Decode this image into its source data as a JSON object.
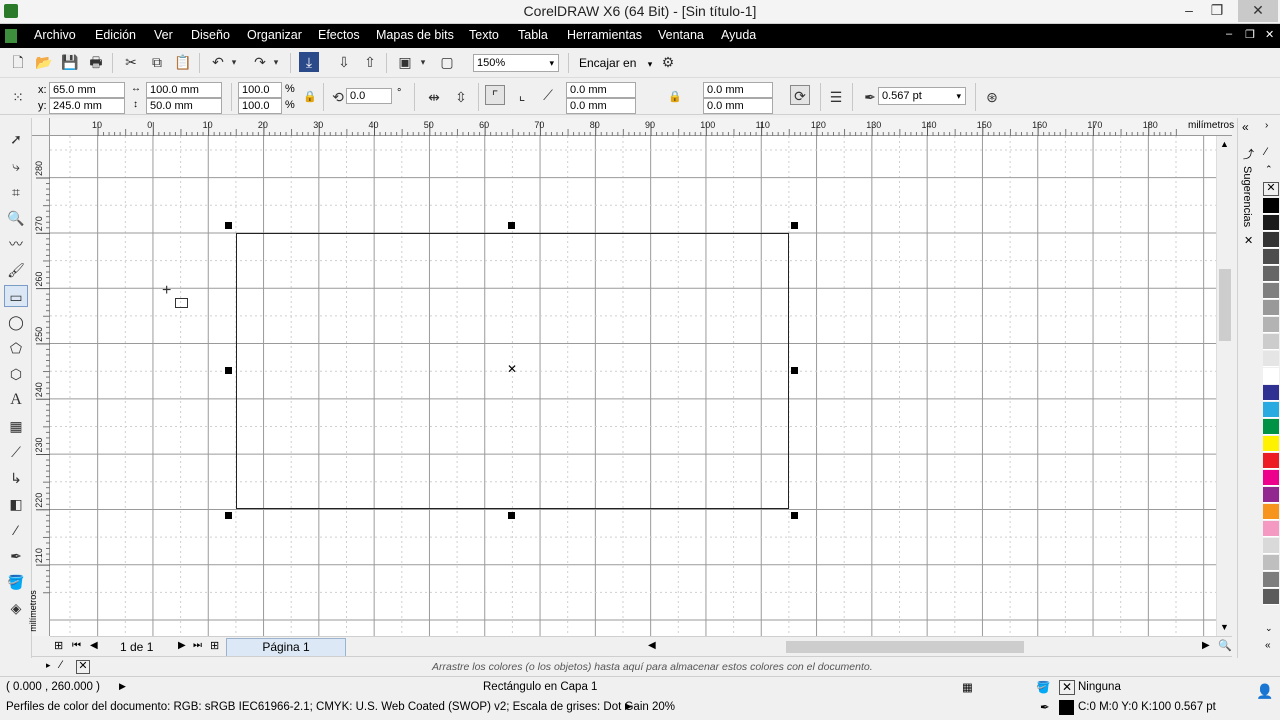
{
  "window": {
    "title": "CorelDRAW X6 (64 Bit) - [Sin título-1]",
    "controls": [
      "‒",
      "❐",
      "✕"
    ]
  },
  "menu": {
    "items": [
      "Archivo",
      "Edición",
      "Ver",
      "Diseño",
      "Organizar",
      "Efectos",
      "Mapas de bits",
      "Texto",
      "Tabla",
      "Herramientas",
      "Ventana",
      "Ayuda"
    ]
  },
  "toolbar1": {
    "zoom": "150%",
    "snap": "Encajar en"
  },
  "propbar": {
    "x_label": "x:",
    "x": "65.0 mm",
    "y_label": "y:",
    "y": "245.0 mm",
    "width": "100.0 mm",
    "height": "50.0 mm",
    "scale_x": "100.0",
    "scale_y": "100.0",
    "percent": "%",
    "rotation": "0.0",
    "degree": "°",
    "corner_tl": "0.0 mm",
    "corner_bl": "0.0 mm",
    "corner_tr": "0.0 mm",
    "corner_br": "0.0 mm",
    "outline": "0.567 pt"
  },
  "rulers": {
    "unit": "milímetros",
    "h_ticks": [
      "10",
      "0",
      "10",
      "20",
      "30",
      "40",
      "50",
      "60",
      "70",
      "80",
      "90",
      "100",
      "110",
      "120",
      "130",
      "140",
      "150",
      "160",
      "170",
      "180"
    ],
    "v_ticks": [
      "280",
      "270",
      "260",
      "250",
      "240",
      "230",
      "220",
      "210"
    ]
  },
  "dock": {
    "tab": "Sugerencias"
  },
  "pages": {
    "counter": "1 de 1",
    "tab": "Página 1"
  },
  "palette_strip": {
    "hint": "Arrastre los colores (o los objetos) hasta aquí para almacenar estos colores con el documento."
  },
  "status": {
    "coords": "( 0.000 , 260.000 )",
    "object": "Rectángulo en Capa 1",
    "fill": "Ninguna",
    "color_profiles": "Perfiles de color del documento: RGB: sRGB IEC61966-2.1; CMYK: U.S. Web Coated (SWOP) v2; Escala de grises: Dot Gain 20%",
    "outline": "C:0 M:0 Y:0 K:100  0.567 pt"
  },
  "colors": {
    "menubar": "#000000",
    "palette": [
      "#000000",
      "#1a1a1a",
      "#333333",
      "#4d4d4d",
      "#666666",
      "#7f7f7f",
      "#999999",
      "#b3b3b3",
      "#cccccc",
      "#e5e5e5",
      "#ffffff",
      "#2e3192",
      "#29abe2",
      "#009245",
      "#fff200",
      "#ed1c24",
      "#ec008c",
      "#92278f",
      "#f7941d",
      "#f49ac2",
      "#d9d9d9",
      "#bfbfbf",
      "#7d7d7d",
      "#5c5c5c"
    ]
  }
}
